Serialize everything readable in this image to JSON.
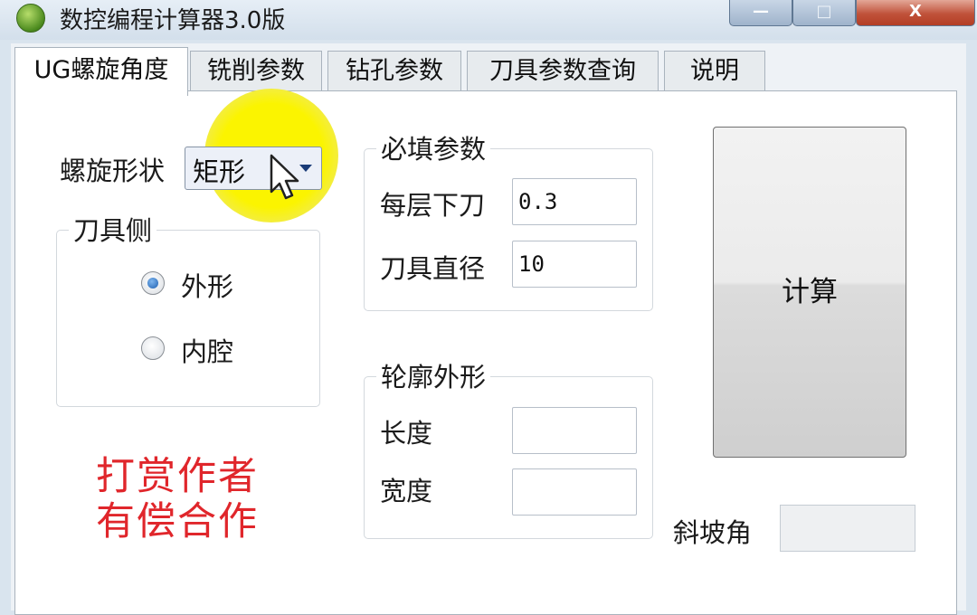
{
  "window": {
    "title": "数控编程计算器3.0版",
    "controls": {
      "minimize": "—",
      "maximize": "□",
      "close": "X"
    }
  },
  "tabs": [
    {
      "label": "UG螺旋角度",
      "active": true
    },
    {
      "label": "铣削参数",
      "active": false
    },
    {
      "label": "钻孔参数",
      "active": false
    },
    {
      "label": "刀具参数查询",
      "active": false
    },
    {
      "label": "说明",
      "active": false
    }
  ],
  "spiral": {
    "shape_label": "螺旋形状",
    "shape_value": "矩形"
  },
  "tool_side": {
    "title": "刀具侧",
    "options": [
      {
        "label": "外形",
        "checked": true
      },
      {
        "label": "内腔",
        "checked": false
      }
    ]
  },
  "required_params": {
    "title": "必填参数",
    "fields": [
      {
        "label": "每层下刀",
        "value": "0.3"
      },
      {
        "label": "刀具直径",
        "value": "10"
      }
    ]
  },
  "contour": {
    "title": "轮廓外形",
    "fields": [
      {
        "label": "长度",
        "value": ""
      },
      {
        "label": "宽度",
        "value": ""
      }
    ]
  },
  "calculate_button": "计算",
  "ramp_angle": {
    "label": "斜坡角",
    "value": ""
  },
  "promo": {
    "line1": "打赏作者",
    "line2": "有偿合作"
  },
  "colors": {
    "highlight": "#fbf400",
    "promo_text": "#e0262b",
    "close_button": "#c0523a",
    "accent": "#1d5fb0"
  }
}
